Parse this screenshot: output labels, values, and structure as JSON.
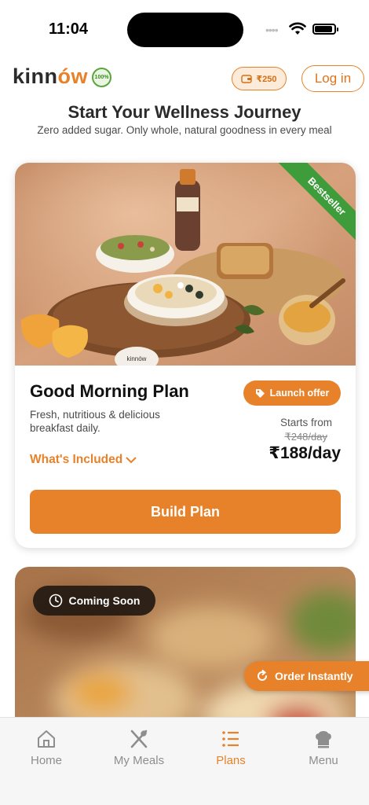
{
  "status_bar": {
    "time": "11:04"
  },
  "header": {
    "logo_text_a": "kinn",
    "logo_text_b": "ów",
    "organic_badge": "100%",
    "wallet_amount": "₹250",
    "login_label": "Log in"
  },
  "hero": {
    "title": "Start Your Wellness Journey",
    "subtitle": "Zero added sugar. Only whole, natural goodness in every meal"
  },
  "plan_card": {
    "ribbon": "Bestseller",
    "jar_label": "kinnów",
    "name": "Good Morning Plan",
    "badge": "Launch offer",
    "description": "Fresh, nutritious & delicious breakfast daily.",
    "starts_from": "Starts from",
    "old_price": "₹248/day",
    "new_price": "₹188/day",
    "whats_included": "What's Included",
    "build_button": "Build Plan"
  },
  "coming_card": {
    "badge": "Coming Soon"
  },
  "floating": {
    "order_instantly": "Order Instantly"
  },
  "bottom_nav": {
    "items": [
      {
        "label": "Home",
        "icon": "home-icon",
        "active": false
      },
      {
        "label": "My Meals",
        "icon": "fork-knife-icon",
        "active": false
      },
      {
        "label": "Plans",
        "icon": "list-icon",
        "active": true
      },
      {
        "label": "Menu",
        "icon": "chef-hat-icon",
        "active": false
      }
    ]
  },
  "colors": {
    "accent": "#e8822a",
    "ribbon": "#3f9c3a",
    "text": "#1a1a1a"
  }
}
